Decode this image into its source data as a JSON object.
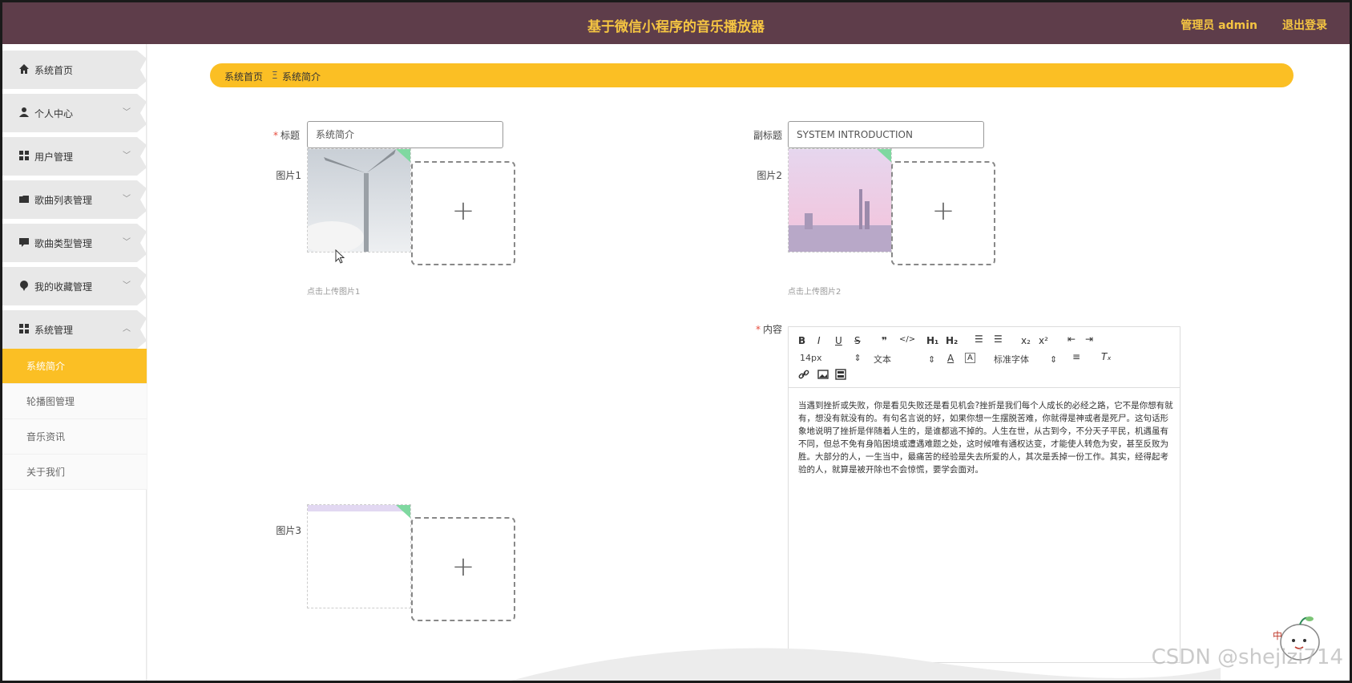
{
  "header": {
    "title": "基于微信小程序的音乐播放器",
    "admin_label": "管理员 admin",
    "logout_label": "退出登录"
  },
  "sidebar": {
    "items": [
      {
        "label": "系统首页",
        "icon": "home-icon"
      },
      {
        "label": "个人中心",
        "icon": "user-icon"
      },
      {
        "label": "用户管理",
        "icon": "grid-icon"
      },
      {
        "label": "歌曲列表管理",
        "icon": "folder-icon"
      },
      {
        "label": "歌曲类型管理",
        "icon": "comment-icon"
      },
      {
        "label": "我的收藏管理",
        "icon": "pin-icon"
      },
      {
        "label": "系统管理",
        "icon": "grid-icon"
      }
    ],
    "sub_items": [
      {
        "label": "系统简介",
        "active": true
      },
      {
        "label": "轮播图管理",
        "active": false
      },
      {
        "label": "音乐资讯",
        "active": false
      },
      {
        "label": "关于我们",
        "active": false
      }
    ]
  },
  "breadcrumb": {
    "home": "系统首页",
    "separator": "Ξ",
    "current": "系统简介"
  },
  "form": {
    "title_label": "标题",
    "title_value": "系统简介",
    "subtitle_label": "副标题",
    "subtitle_value": "SYSTEM INTRODUCTION",
    "image1_label": "图片1",
    "image1_hint": "点击上传图片1",
    "image2_label": "图片2",
    "image2_hint": "点击上传图片2",
    "image3_label": "图片3",
    "plus": "+",
    "content_label": "内容"
  },
  "editor": {
    "font_size": "14px",
    "text_type": "文本",
    "font_family": "标准字体",
    "content": "当遇到挫折或失败，你是看见失败还是看见机会?挫折是我们每个人成长的必经之路，它不是你想有就有，想没有就没有的。有句名言说的好，如果你想一生摆脱苦难，你就得是神或者是死尸。这句话形象地说明了挫折是伴随着人生的，是谁都逃不掉的。人生在世，从古到今，不分天子平民，机遇虽有不同，但总不免有身陷困境或遭遇难题之处，这时候唯有通权达变，才能使人转危为安，甚至反败为胜。大部分的人，一生当中，最痛苦的经验是失去所爱的人，其次是丢掉一份工作。其实，经得起考验的人，就算是被开除也不会惊慌，要学会面对。"
  },
  "watermark": "CSDN @shejizi714",
  "colors": {
    "header_bg": "#5e3d4a",
    "accent": "#fbbf24",
    "header_text": "#f5c542"
  }
}
